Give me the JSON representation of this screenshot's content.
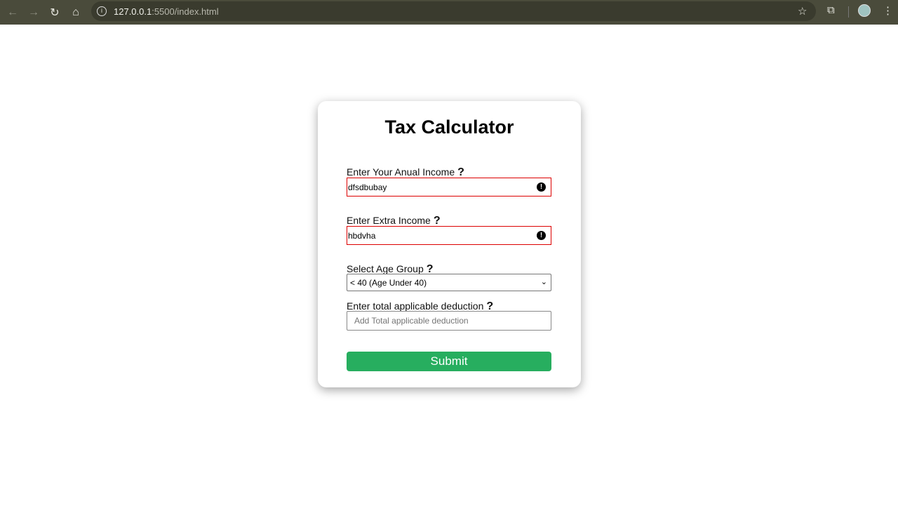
{
  "browser": {
    "url_host": "127.0.0.1",
    "url_rest": ":5500/index.html"
  },
  "form": {
    "title": "Tax Calculator",
    "help": "?",
    "annual_income": {
      "label": "Enter Your Anual Income",
      "value": "dfsdbubay"
    },
    "extra_income": {
      "label": "Enter Extra Income",
      "value": "hbdvha"
    },
    "age_group": {
      "label": "Select Age Group",
      "value": "< 40 (Age Under 40)"
    },
    "deduction": {
      "label": "Enter total applicable deduction",
      "placeholder": "Add Total applicable deduction"
    },
    "submit_label": "Submit",
    "error_color": "#dd0000",
    "submit_color": "#27ae5f"
  }
}
